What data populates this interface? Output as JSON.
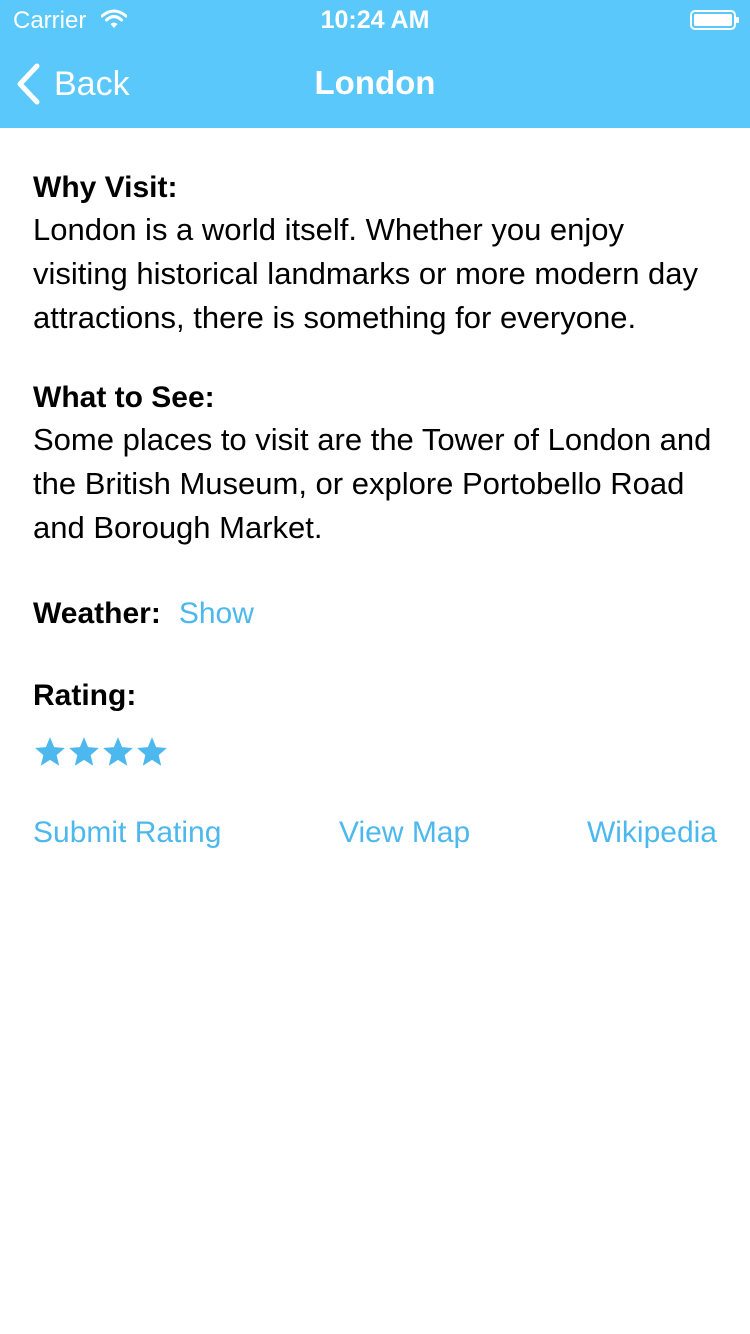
{
  "status_bar": {
    "carrier": "Carrier",
    "time": "10:24 AM",
    "wifi_icon": "wifi-icon",
    "battery_icon": "battery-icon"
  },
  "nav_bar": {
    "back_label": "Back",
    "back_icon": "chevron-left-icon",
    "title": "London",
    "background_color": "#5ac8fa"
  },
  "why_visit": {
    "title": "Why Visit:",
    "body": "London is a world itself. Whether you enjoy visiting historical landmarks or more modern day attractions, there is something for everyone."
  },
  "what_to_see": {
    "title": "What to See:",
    "body": "Some places to visit are the Tower of London and the British Museum, or explore Portobello Road and Borough Market."
  },
  "weather": {
    "title": "Weather:",
    "link_label": "Show"
  },
  "rating": {
    "title": "Rating:",
    "stars": 4,
    "star_icon": "star-icon",
    "accent_color": "#4cb8ee"
  },
  "actions": {
    "submit_rating": "Submit Rating",
    "view_map": "View Map",
    "wikipedia": "Wikipedia"
  }
}
